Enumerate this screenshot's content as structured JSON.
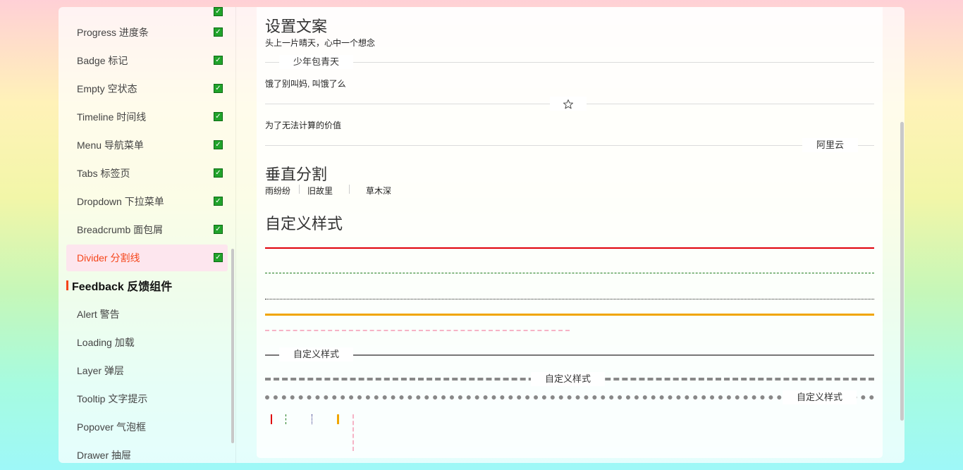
{
  "sidebar": {
    "items": [
      {
        "label": "Progress 进度条",
        "checked": true
      },
      {
        "label": "Badge 标记",
        "checked": true
      },
      {
        "label": "Empty 空状态",
        "checked": true
      },
      {
        "label": "Timeline 时间线",
        "checked": true
      },
      {
        "label": "Menu 导航菜单",
        "checked": true
      },
      {
        "label": "Tabs 标签页",
        "checked": true
      },
      {
        "label": "Dropdown 下拉菜单",
        "checked": true
      },
      {
        "label": "Breadcrumb 面包屑",
        "checked": true
      },
      {
        "label": "Divider 分割线",
        "checked": true,
        "active": true
      }
    ],
    "group_title": "Feedback 反馈组件",
    "group_items": [
      {
        "label": "Alert 警告"
      },
      {
        "label": "Loading 加载"
      },
      {
        "label": "Layer 弹层"
      },
      {
        "label": "Tooltip 文字提示"
      },
      {
        "label": "Popover 气泡框"
      },
      {
        "label": "Drawer 抽屉"
      }
    ],
    "active_color": "#f5451a"
  },
  "main": {
    "section1": {
      "title": "设置文案",
      "subtitle": "头上一片晴天，心中一个想念",
      "divider1_text": "少年包青天",
      "text2": "饿了别叫妈, 叫饿了么",
      "divider2_icon": "star-outline-icon",
      "text3": "为了无法计算的价值",
      "divider3_text": "阿里云"
    },
    "section2": {
      "title": "垂直分割",
      "items": [
        "雨纷纷",
        "旧故里",
        "草木深"
      ]
    },
    "section3": {
      "title": "自定义样式",
      "line_colors": [
        "#e0000a",
        "#1b7a1b",
        "#222222",
        "#f0a500",
        "#f6b3c6",
        "#808080"
      ],
      "text_divider_solid": "自定义样式",
      "text_divider_dashed": "自定义样式",
      "text_divider_dotted": "自定义样式"
    }
  }
}
